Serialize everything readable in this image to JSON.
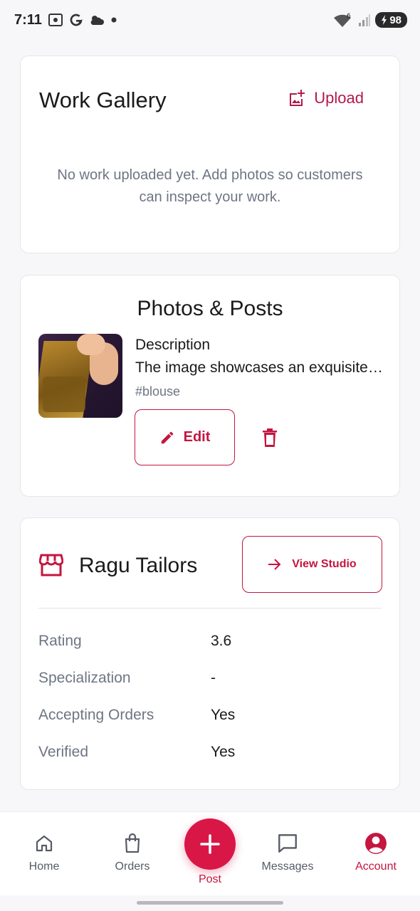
{
  "status_bar": {
    "time": "7:11",
    "battery": "98",
    "network_badge": "6"
  },
  "gallery": {
    "title": "Work Gallery",
    "upload_label": "Upload",
    "empty_message": "No work uploaded yet. Add photos so customers can inspect your work."
  },
  "posts": {
    "title": "Photos & Posts",
    "items": [
      {
        "description_label": "Description",
        "description": "The image showcases an exquisite blouse",
        "tag": "#blouse",
        "edit_label": "Edit"
      }
    ]
  },
  "tailor": {
    "name": "Ragu Tailors",
    "view_studio_label": "View Studio",
    "rows": [
      {
        "label": "Rating",
        "value": "3.6"
      },
      {
        "label": "Specialization",
        "value": "-"
      },
      {
        "label": "Accepting Orders",
        "value": "Yes"
      },
      {
        "label": "Verified",
        "value": "Yes"
      }
    ]
  },
  "nav": {
    "home": "Home",
    "orders": "Orders",
    "post": "Post",
    "messages": "Messages",
    "account": "Account",
    "active": "account"
  },
  "colors": {
    "accent": "#c4163f",
    "fab": "#d81747",
    "muted_text": "#6e7583",
    "background": "#f7f7f9"
  }
}
